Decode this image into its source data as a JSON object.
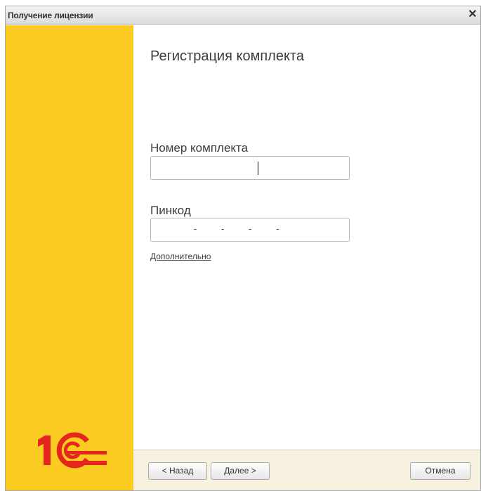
{
  "window": {
    "title": "Получение лицензии"
  },
  "page": {
    "heading": "Регистрация комплекта"
  },
  "form": {
    "kit_number_label": "Номер комплекта",
    "kit_number_value": "",
    "pincode_label": "Пинкод",
    "pincode_mask": "     -    -    -    -",
    "more_link": "Дополнительно"
  },
  "buttons": {
    "back": "< Назад",
    "next": "Далее >",
    "cancel": "Отмена"
  },
  "colors": {
    "sidebar": "#fccb22",
    "logo_red": "#e4261c"
  },
  "icons": {
    "close": "close-icon",
    "logo": "1c-logo"
  }
}
